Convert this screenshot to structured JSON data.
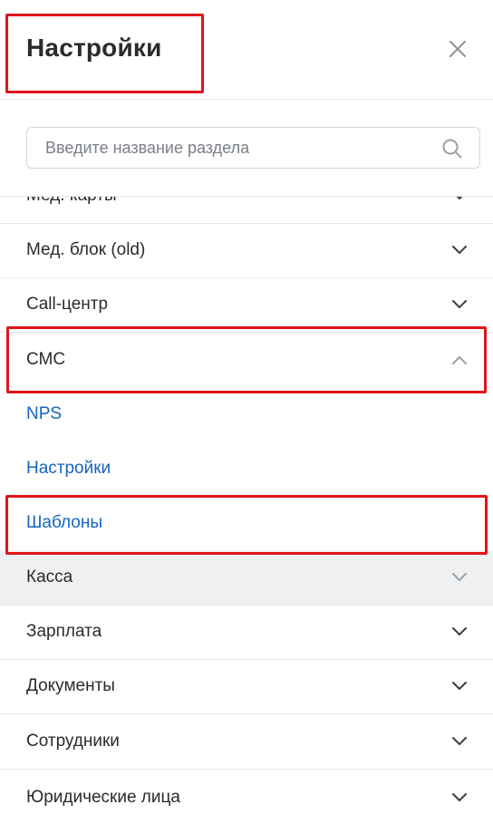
{
  "panel": {
    "title": "Настройки",
    "close_icon": "close-icon"
  },
  "search": {
    "placeholder": "Введите название раздела",
    "value": "",
    "icon": "search-icon"
  },
  "menu": {
    "partial_item": {
      "label": "Мед. карты",
      "state": "collapsed"
    },
    "items": [
      {
        "label": "Мед. блок (old)",
        "state": "collapsed"
      },
      {
        "label": "Call-центр",
        "state": "collapsed"
      },
      {
        "label": "СМС",
        "state": "expanded"
      },
      {
        "label": "Касса",
        "state": "collapsed"
      },
      {
        "label": "Зарплата",
        "state": "collapsed"
      },
      {
        "label": "Документы",
        "state": "collapsed"
      },
      {
        "label": "Сотрудники",
        "state": "collapsed"
      },
      {
        "label": "Юридические лица",
        "state": "collapsed"
      }
    ],
    "sms_subitems": [
      {
        "label": "NPS"
      },
      {
        "label": "Настройки"
      },
      {
        "label": "Шаблоны"
      }
    ]
  },
  "colors": {
    "link": "#1565c0",
    "highlight": "#e0131b",
    "divider": "#e6e8eb",
    "hover_row": "#eef0f2"
  }
}
